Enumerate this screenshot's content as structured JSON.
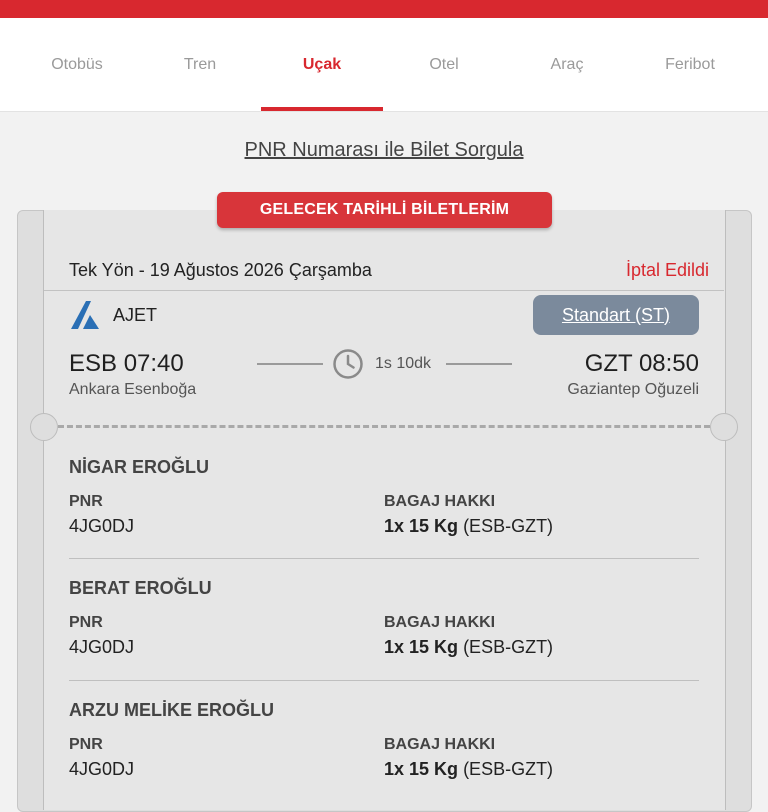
{
  "tabs": [
    {
      "label": "Otobüs",
      "active": false
    },
    {
      "label": "Tren",
      "active": false
    },
    {
      "label": "Uçak",
      "active": true
    },
    {
      "label": "Otel",
      "active": false
    },
    {
      "label": "Araç",
      "active": false
    },
    {
      "label": "Feribot",
      "active": false
    }
  ],
  "pnr_query_link": "PNR Numarası ile Bilet Sorgula",
  "section_title": "GELECEK TARİHLİ BİLETLERİM",
  "ticket": {
    "trip_title": "Tek Yön - 19 Ağustos 2026 Çarşamba",
    "status": "İptal Edildi",
    "airline": "AJET",
    "fare_class": "Standart (ST)",
    "departure": {
      "time": "ESB 07:40",
      "city": "Ankara Esenboğa"
    },
    "arrival": {
      "time": "GZT 08:50",
      "city": "Gaziantep Oğuzeli"
    },
    "duration": "1s 10dk"
  },
  "passengers": [
    {
      "name": "NİGAR EROĞLU",
      "pnr_label": "PNR",
      "pnr": "4JG0DJ",
      "baggage_label": "BAGAJ HAKKI",
      "baggage_amount": "1x 15 Kg",
      "baggage_route": "(ESB-GZT)"
    },
    {
      "name": "BERAT EROĞLU",
      "pnr_label": "PNR",
      "pnr": "4JG0DJ",
      "baggage_label": "BAGAJ HAKKI",
      "baggage_amount": "1x 15 Kg",
      "baggage_route": "(ESB-GZT)"
    },
    {
      "name": "ARZU MELİKE EROĞLU",
      "pnr_label": "PNR",
      "pnr": "4JG0DJ",
      "baggage_label": "BAGAJ HAKKI",
      "baggage_amount": "1x 15 Kg",
      "baggage_route": "(ESB-GZT)"
    }
  ],
  "colors": {
    "brand_red": "#d8282f",
    "fare_button": "#7b8a9c",
    "airline_logo": "#2a6fb5"
  }
}
